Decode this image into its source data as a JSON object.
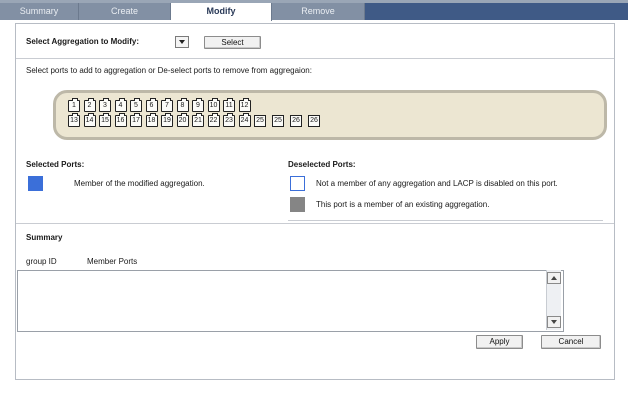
{
  "tabs": [
    {
      "label": "Summary",
      "active": false
    },
    {
      "label": "Create",
      "active": false
    },
    {
      "label": "Modify",
      "active": true
    },
    {
      "label": "Remove",
      "active": false
    }
  ],
  "select_row": {
    "label": "Select Aggregation to Modify:",
    "dropdown_value": "",
    "button_label": "Select"
  },
  "instructions": "Select ports to add to aggregation or De-select ports to remove from aggregaion:",
  "ports": {
    "row1": [
      "1",
      "2",
      "3",
      "4",
      "5",
      "6",
      "7",
      "8",
      "9",
      "10",
      "11",
      "12"
    ],
    "row2": [
      "13",
      "14",
      "15",
      "16",
      "17",
      "18",
      "19",
      "20",
      "21",
      "22",
      "23",
      "24"
    ],
    "sfp": [
      "25",
      "25",
      "26",
      "26"
    ]
  },
  "legend": {
    "selected_title": "Selected Ports:",
    "selected_desc": "Member of the modified aggregation.",
    "selected_color": "#3b6fd9",
    "deselected_title": "Deselected Ports:",
    "deselected_desc_1": "Not a member of any aggregation and LACP is disabled on this port.",
    "deselected_color_1": "#ffffff",
    "deselected_desc_2": "This port is a member of an existing aggregation.",
    "deselected_color_2": "#858585"
  },
  "summary": {
    "title": "Summary",
    "col_group_id": "group ID",
    "col_member_ports": "Member Ports",
    "rows": []
  },
  "buttons": {
    "apply": "Apply",
    "cancel": "Cancel"
  }
}
